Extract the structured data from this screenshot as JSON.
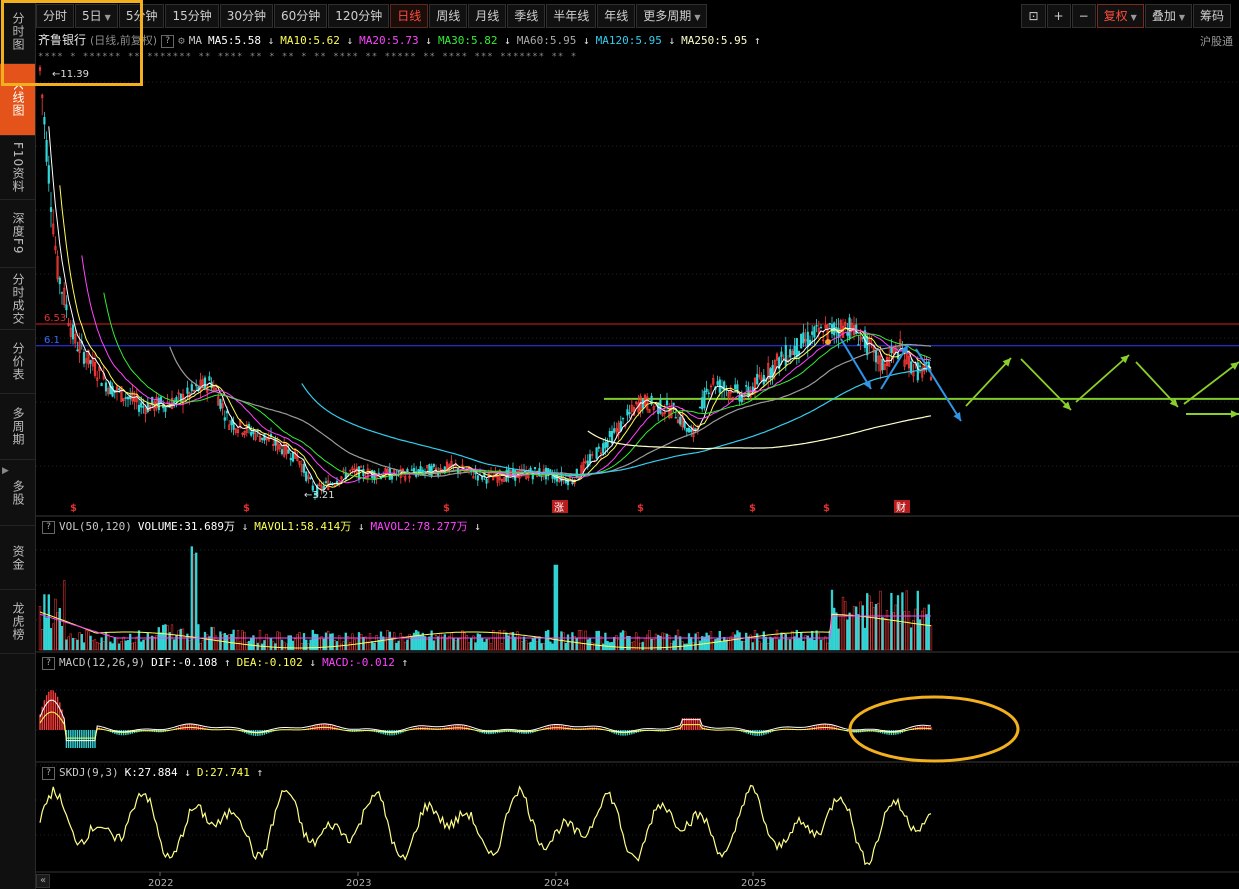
{
  "left_nav": [
    {
      "label": "分时图",
      "active": false
    },
    {
      "label": "K线图",
      "active": true
    },
    {
      "label": "F10资料",
      "active": false
    },
    {
      "label": "深度F9",
      "active": false
    },
    {
      "label": "分时成交",
      "active": false
    },
    {
      "label": "分价表",
      "active": false
    },
    {
      "label": "多周期",
      "active": false
    },
    {
      "label": "多股",
      "active": false
    },
    {
      "label": "资金",
      "active": false
    },
    {
      "label": "龙虎榜",
      "active": false
    }
  ],
  "toolbar": {
    "items": [
      "分时",
      "5日",
      "5分钟",
      "15分钟",
      "30分钟",
      "60分钟",
      "120分钟",
      "日线",
      "周线",
      "月线",
      "季线",
      "半年线",
      "年线",
      "更多周期"
    ],
    "active": "日线",
    "right_items": [
      "复权",
      "叠加",
      "筹码"
    ],
    "right_icons": [
      "unlock-icon",
      "plus-icon",
      "minus-icon"
    ]
  },
  "stock": {
    "name": "齐鲁银行",
    "mode": "(日线,前复权)",
    "market_tag": "沪股通"
  },
  "ma_line": {
    "label": "MA",
    "items": [
      {
        "text": "MA5:5.58",
        "dir": "↓",
        "color": "#ffffff"
      },
      {
        "text": "MA10:5.62",
        "dir": "↓",
        "color": "#ffff55"
      },
      {
        "text": "MA20:5.73",
        "dir": "↓",
        "color": "#ff44ff"
      },
      {
        "text": "MA30:5.82",
        "dir": "↓",
        "color": "#33ee33"
      },
      {
        "text": "MA60:5.95",
        "dir": "↓",
        "color": "#aaaaaa"
      },
      {
        "text": "MA120:5.95",
        "dir": "↓",
        "color": "#33ccee"
      },
      {
        "text": "MA250:5.95",
        "dir": "↑",
        "color": "#ffffcc"
      }
    ]
  },
  "ticker_text": "**** * ****** ** ******* ** **** ** * ** * ** **** ** ***** ** **** *** ******* ** *",
  "vol_line": {
    "label": "VOL(50,120)",
    "items": [
      {
        "text": "VOLUME:31.689万",
        "dir": "↓",
        "color": "#ffffff"
      },
      {
        "text": "MAVOL1:58.414万",
        "dir": "↓",
        "color": "#ffff55"
      },
      {
        "text": "MAVOL2:78.277万",
        "dir": "↓",
        "color": "#ff44ff"
      }
    ]
  },
  "macd_line": {
    "label": "MACD(12,26,9)",
    "items": [
      {
        "text": "DIF:-0.108",
        "dir": "↑",
        "color": "#ffffff"
      },
      {
        "text": "DEA:-0.102",
        "dir": "↓",
        "color": "#ffff55"
      },
      {
        "text": "MACD:-0.012",
        "dir": "↑",
        "color": "#ff44ff"
      }
    ]
  },
  "skdj_line": {
    "label": "SKDJ(9,3)",
    "items": [
      {
        "text": "K:27.884",
        "dir": "↓",
        "color": "#ffffff"
      },
      {
        "text": "D:27.741",
        "dir": "↑",
        "color": "#ffff55"
      }
    ]
  },
  "chart_data": {
    "type": "candlestick",
    "period": "daily",
    "x_ticks": [
      "2022",
      "2023",
      "2024",
      "2025"
    ],
    "price_annotations": {
      "high": "11.39",
      "low": "3.21",
      "red_line": "6.53",
      "blue_line": "6.1"
    },
    "ref_lines": {
      "red": 6.53,
      "blue": 6.1,
      "green": 5.05
    },
    "event_markers": [
      "$",
      "$",
      "$",
      "涨",
      "$",
      "$",
      "$",
      "财"
    ],
    "price_path": [
      {
        "x": "2021-06",
        "close": 11.39
      },
      {
        "x": "2021-07",
        "close": 7.6
      },
      {
        "x": "2021-08",
        "close": 6.2
      },
      {
        "x": "2021-10",
        "close": 5.3
      },
      {
        "x": "2021-12",
        "close": 4.9
      },
      {
        "x": "2022-02",
        "close": 5.0
      },
      {
        "x": "2022-04",
        "close": 5.4
      },
      {
        "x": "2022-05",
        "close": 4.6
      },
      {
        "x": "2022-07",
        "close": 4.3
      },
      {
        "x": "2022-09",
        "close": 3.9
      },
      {
        "x": "2022-10",
        "close": 3.21
      },
      {
        "x": "2022-12",
        "close": 3.6
      },
      {
        "x": "2023-03",
        "close": 3.55
      },
      {
        "x": "2023-06",
        "close": 3.7
      },
      {
        "x": "2023-08",
        "close": 3.5
      },
      {
        "x": "2023-11",
        "close": 3.6
      },
      {
        "x": "2024-01",
        "close": 3.45
      },
      {
        "x": "2024-03",
        "close": 4.2
      },
      {
        "x": "2024-05",
        "close": 5.0
      },
      {
        "x": "2024-07",
        "close": 4.8
      },
      {
        "x": "2024-08",
        "close": 4.3
      },
      {
        "x": "2024-09",
        "close": 5.4
      },
      {
        "x": "2024-11",
        "close": 5.1
      },
      {
        "x": "2025-01",
        "close": 5.8
      },
      {
        "x": "2025-03",
        "close": 6.3
      },
      {
        "x": "2025-05",
        "close": 6.5
      },
      {
        "x": "2025-06",
        "close": 6.2
      },
      {
        "x": "2025-07",
        "close": 5.7
      },
      {
        "x": "2025-08",
        "close": 6.05
      },
      {
        "x": "2025-09",
        "close": 5.6
      }
    ],
    "annotation_arrows": {
      "blue_arrows": 3,
      "green_zigzag_arrows": 6,
      "orange_ellipse": "MACD"
    }
  },
  "colors": {
    "up": "#ff3b3b",
    "down": "#33d6d6",
    "red_line": "#d42020",
    "blue_line": "#2a3cff",
    "green_line": "#7fcc2a",
    "green_arrow": "#8bd02a",
    "blue_arrow": "#2f95e8",
    "highlight": "#f2b01e",
    "accent": "#e4541a"
  }
}
